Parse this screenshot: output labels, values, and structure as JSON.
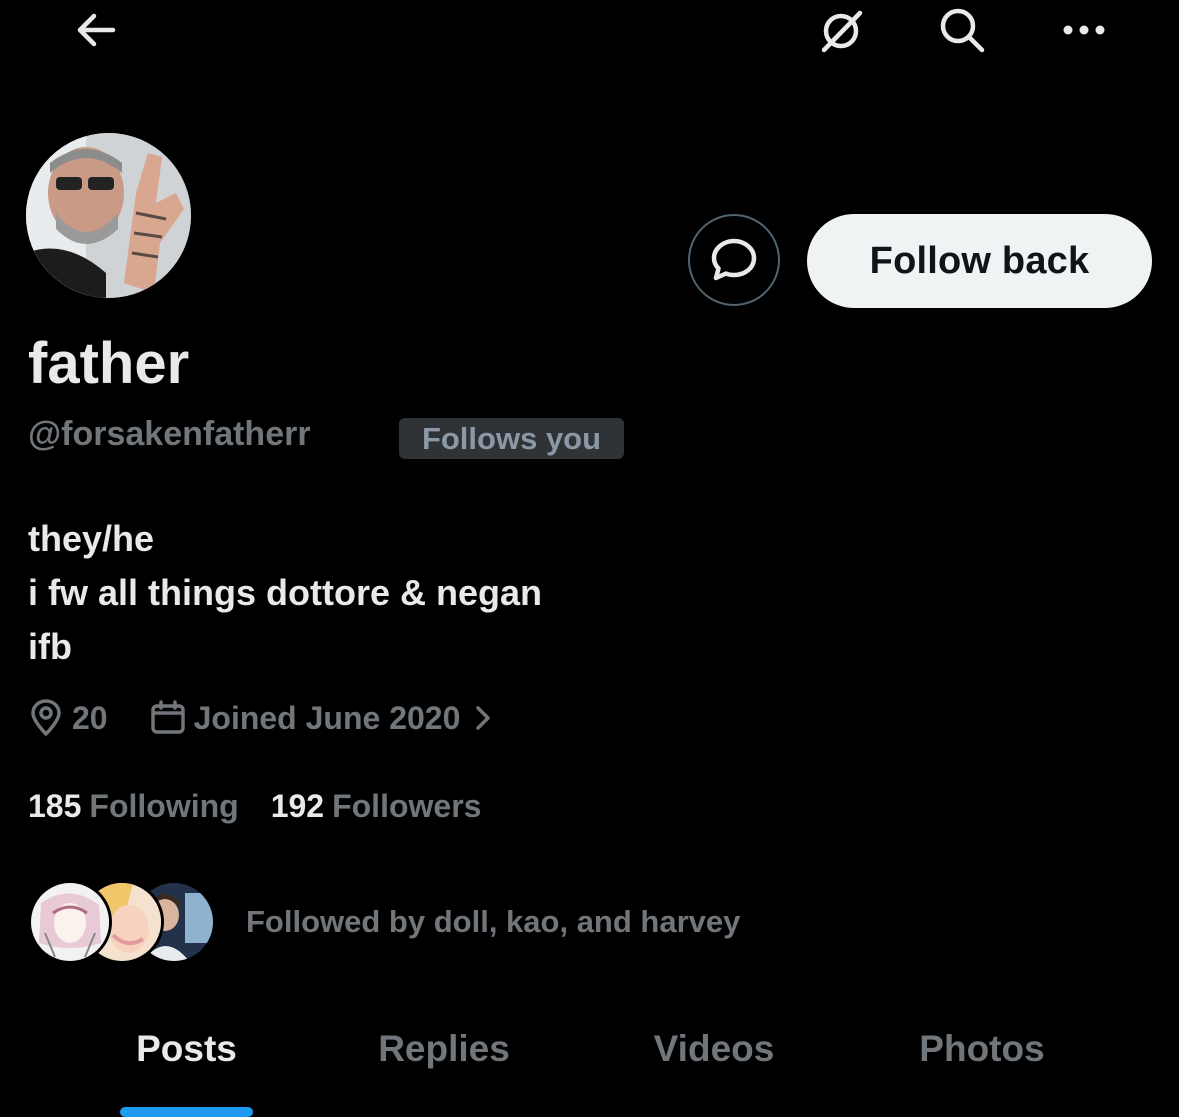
{
  "topbar": {
    "back_icon": "arrow-left-icon",
    "grok_icon": "grok-icon",
    "search_icon": "search-icon",
    "more_icon": "more-dots-icon"
  },
  "profile": {
    "display_name": "father",
    "handle": "@forsakenfatherr",
    "follows_you_badge": "Follows you",
    "bio_lines": [
      "they/he",
      "i fw all things dottore & negan",
      "ifb"
    ],
    "location": "20",
    "joined": "Joined June 2020",
    "following_count": "185",
    "following_label": "Following",
    "followers_count": "192",
    "followers_label": "Followers",
    "followed_by_text": "Followed by doll, kao, and harvey"
  },
  "actions": {
    "message_icon": "message-bubble-icon",
    "follow_label": "Follow back"
  },
  "tabs": [
    {
      "label": "Posts",
      "active": true
    },
    {
      "label": "Replies",
      "active": false
    },
    {
      "label": "Videos",
      "active": false
    },
    {
      "label": "Photos",
      "active": false
    }
  ],
  "colors": {
    "background": "#000000",
    "text_primary": "#e7e9ea",
    "text_secondary": "#71767b",
    "accent": "#1d9bf0",
    "button_bg": "#eff3f4"
  }
}
